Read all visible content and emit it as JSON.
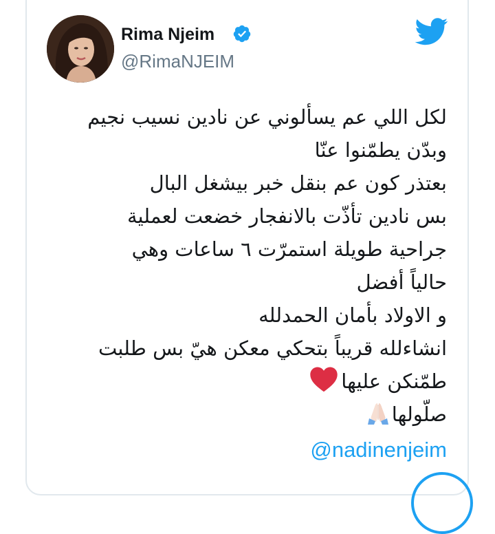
{
  "author": {
    "name": "Rima Njeim",
    "handle": "@RimaNJEIM",
    "verified": true,
    "avatar": "profile-photo"
  },
  "brand": {
    "icon": "twitter-bird-icon",
    "color": "#1da1f2"
  },
  "tweet": {
    "lines": [
      "لكل اللي عم يسألوني عن نادين نسيب نجيم",
      "وبدّن يطمّنوا عنّا",
      "بعتذر كون عم بنقل خبر بيشغل البال",
      "بس نادين تأذّت بالانفجار خضعت لعملية",
      "جراحية طويلة استمرّت ٦ ساعات وهي",
      "حالياً أفضل",
      "و الاولاد بأمان الحمدلله",
      "انشاءلله قريباً بتحكي معكن هيّ بس طلبت",
      "طمّنكن عليها",
      "صلّولها"
    ],
    "emoji": {
      "heart": "red-heart-icon",
      "pray": "folded-hands-icon"
    },
    "mention": "@nadinenjeim"
  }
}
